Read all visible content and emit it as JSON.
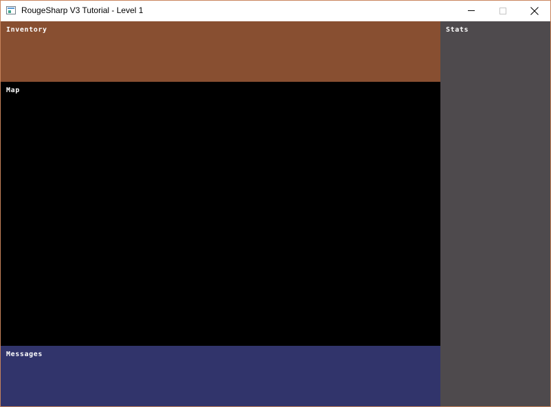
{
  "window": {
    "title": "RougeSharp V3 Tutorial - Level 1",
    "icon": "app-window-icon",
    "controls": [
      "minimize-icon",
      "maximize-icon",
      "close-icon"
    ]
  },
  "panels": {
    "inventory": {
      "label": "Inventory",
      "color": "#884f31"
    },
    "map": {
      "label": "Map",
      "color": "#000000"
    },
    "messages": {
      "label": "Messages",
      "color": "#31346b"
    },
    "stats": {
      "label": "Stats",
      "color": "#4e4a4d"
    }
  }
}
